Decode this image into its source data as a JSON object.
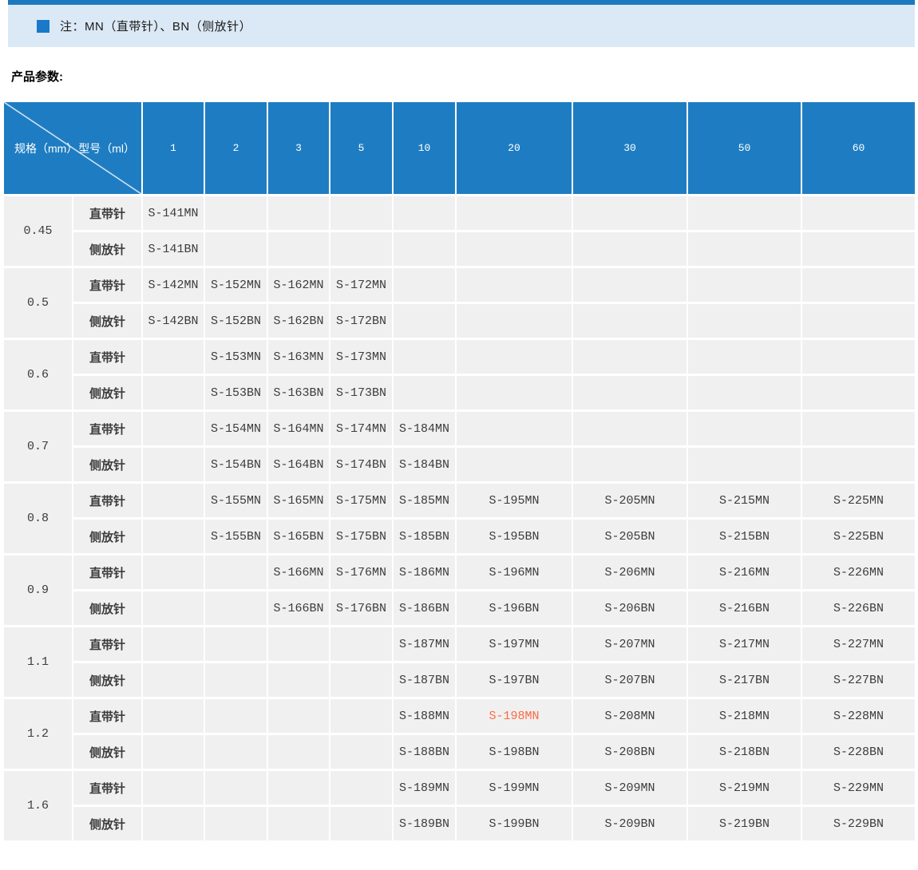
{
  "note": {
    "text": "注：MN（直带针）、BN（侧放针）"
  },
  "section_title": "产品参数:",
  "colors": {
    "accent_blue": "#1e7dc2",
    "topbar_blue": "#1e78be",
    "banner_bg": "#dbe9f6",
    "cell_bg": "#f0f0f0",
    "highlight_orange": "#fb6a43"
  },
  "table": {
    "header": {
      "spec_label": "规格（mm）",
      "model_label": "型号（ml）",
      "volumes": [
        "1",
        "2",
        "3",
        "5",
        "10",
        "20",
        "30",
        "50",
        "60"
      ]
    },
    "highlight_code": "S-198MN",
    "groups": [
      {
        "spec": "0.45",
        "rows": [
          {
            "type": "直带针",
            "cells": [
              "S-141MN",
              "",
              "",
              "",
              "",
              "",
              "",
              "",
              ""
            ]
          },
          {
            "type": "侧放针",
            "cells": [
              "S-141BN",
              "",
              "",
              "",
              "",
              "",
              "",
              "",
              ""
            ]
          }
        ]
      },
      {
        "spec": "0.5",
        "rows": [
          {
            "type": "直带针",
            "cells": [
              "S-142MN",
              "S-152MN",
              "S-162MN",
              "S-172MN",
              "",
              "",
              "",
              "",
              ""
            ]
          },
          {
            "type": "侧放针",
            "cells": [
              "S-142BN",
              "S-152BN",
              "S-162BN",
              "S-172BN",
              "",
              "",
              "",
              "",
              ""
            ]
          }
        ]
      },
      {
        "spec": "0.6",
        "rows": [
          {
            "type": "直带针",
            "cells": [
              "",
              "S-153MN",
              "S-163MN",
              "S-173MN",
              "",
              "",
              "",
              "",
              ""
            ]
          },
          {
            "type": "侧放针",
            "cells": [
              "",
              "S-153BN",
              "S-163BN",
              "S-173BN",
              "",
              "",
              "",
              "",
              ""
            ]
          }
        ]
      },
      {
        "spec": "0.7",
        "rows": [
          {
            "type": "直带针",
            "cells": [
              "",
              "S-154MN",
              "S-164MN",
              "S-174MN",
              "S-184MN",
              "",
              "",
              "",
              ""
            ]
          },
          {
            "type": "侧放针",
            "cells": [
              "",
              "S-154BN",
              "S-164BN",
              "S-174BN",
              "S-184BN",
              "",
              "",
              "",
              ""
            ]
          }
        ]
      },
      {
        "spec": "0.8",
        "rows": [
          {
            "type": "直带针",
            "cells": [
              "",
              "S-155MN",
              "S-165MN",
              "S-175MN",
              "S-185MN",
              "S-195MN",
              "S-205MN",
              "S-215MN",
              "S-225MN"
            ]
          },
          {
            "type": "侧放针",
            "cells": [
              "",
              "S-155BN",
              "S-165BN",
              "S-175BN",
              "S-185BN",
              "S-195BN",
              "S-205BN",
              "S-215BN",
              "S-225BN"
            ]
          }
        ]
      },
      {
        "spec": "0.9",
        "rows": [
          {
            "type": "直带针",
            "cells": [
              "",
              "",
              "S-166MN",
              "S-176MN",
              "S-186MN",
              "S-196MN",
              "S-206MN",
              "S-216MN",
              "S-226MN"
            ]
          },
          {
            "type": "侧放针",
            "cells": [
              "",
              "",
              "S-166BN",
              "S-176BN",
              "S-186BN",
              "S-196BN",
              "S-206BN",
              "S-216BN",
              "S-226BN"
            ]
          }
        ]
      },
      {
        "spec": "1.1",
        "rows": [
          {
            "type": "直带针",
            "cells": [
              "",
              "",
              "",
              "",
              "S-187MN",
              "S-197MN",
              "S-207MN",
              "S-217MN",
              "S-227MN"
            ]
          },
          {
            "type": "侧放针",
            "cells": [
              "",
              "",
              "",
              "",
              "S-187BN",
              "S-197BN",
              "S-207BN",
              "S-217BN",
              "S-227BN"
            ]
          }
        ]
      },
      {
        "spec": "1.2",
        "rows": [
          {
            "type": "直带针",
            "cells": [
              "",
              "",
              "",
              "",
              "S-188MN",
              "S-198MN",
              "S-208MN",
              "S-218MN",
              "S-228MN"
            ]
          },
          {
            "type": "侧放针",
            "cells": [
              "",
              "",
              "",
              "",
              "S-188BN",
              "S-198BN",
              "S-208BN",
              "S-218BN",
              "S-228BN"
            ]
          }
        ]
      },
      {
        "spec": "1.6",
        "rows": [
          {
            "type": "直带针",
            "cells": [
              "",
              "",
              "",
              "",
              "S-189MN",
              "S-199MN",
              "S-209MN",
              "S-219MN",
              "S-229MN"
            ]
          },
          {
            "type": "侧放针",
            "cells": [
              "",
              "",
              "",
              "",
              "S-189BN",
              "S-199BN",
              "S-209BN",
              "S-219BN",
              "S-229BN"
            ]
          }
        ]
      }
    ]
  }
}
